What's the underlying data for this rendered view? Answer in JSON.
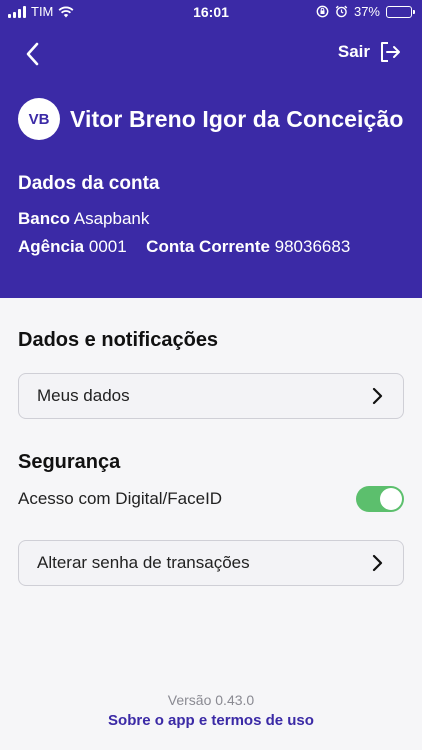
{
  "status_bar": {
    "carrier": "TIM",
    "time": "16:01",
    "battery": "37%",
    "battery_level": 0.37
  },
  "header": {
    "logout_label": "Sair",
    "avatar_initials": "VB",
    "user_name": "Vitor Breno Igor da Conceição",
    "account_title": "Dados da conta",
    "bank_label": "Banco",
    "bank_value": "Asapbank",
    "agency_label": "Agência",
    "agency_value": "0001",
    "account_label": "Conta Corrente",
    "account_value": "98036683"
  },
  "sections": {
    "data_title": "Dados e notificações",
    "my_data_label": "Meus dados",
    "security_title": "Segurança",
    "biometric_label": "Acesso com Digital/FaceID",
    "biometric_enabled": true,
    "change_password_label": "Alterar senha de transações"
  },
  "footer": {
    "version": "Versão 0.43.0",
    "about_link": "Sobre o app e termos de uso"
  },
  "colors": {
    "primary": "#3b2aa6",
    "toggle_on": "#5cbf6d",
    "background": "#f6f6f8"
  }
}
